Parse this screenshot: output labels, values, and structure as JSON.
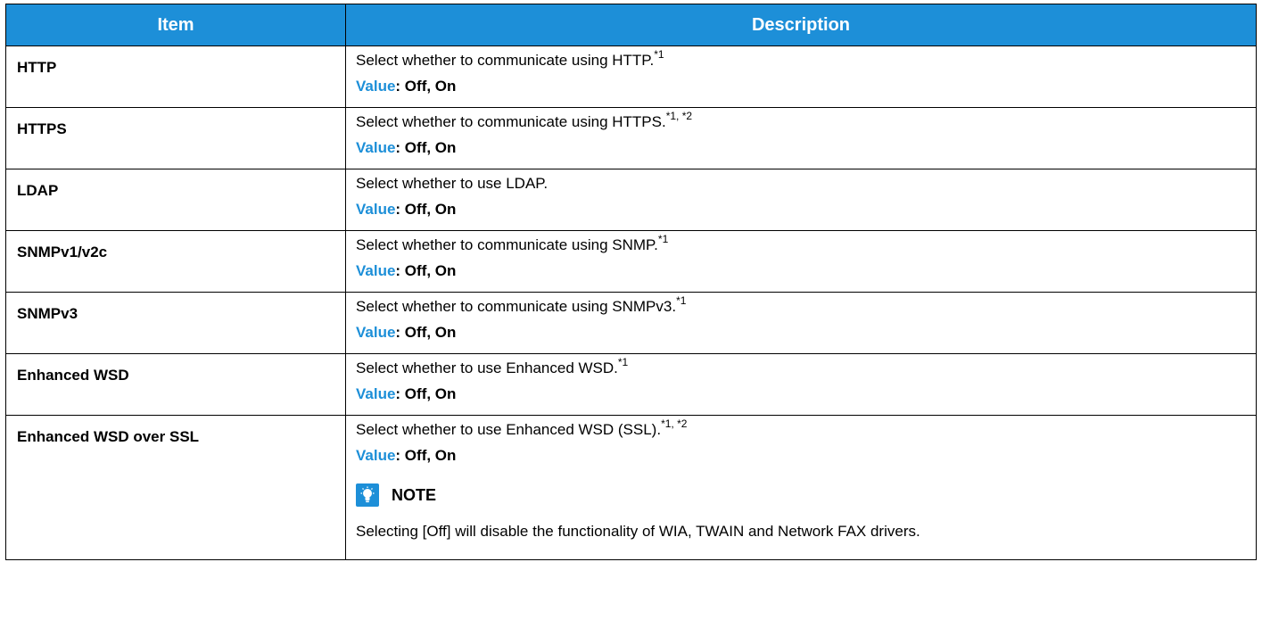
{
  "header": {
    "item": "Item",
    "description": "Description"
  },
  "value_label": "Value",
  "rows": [
    {
      "item": "HTTP",
      "desc": "Select whether to communicate using HTTP.",
      "sup": "*1",
      "value": ": Off, On"
    },
    {
      "item": "HTTPS",
      "desc": "Select whether to communicate using HTTPS.",
      "sup": "*1, *2",
      "value": ": Off, On"
    },
    {
      "item": "LDAP",
      "desc": "Select whether to use LDAP.",
      "sup": "",
      "value": ": Off, On"
    },
    {
      "item": "SNMPv1/v2c",
      "desc": "Select whether to communicate using SNMP.",
      "sup": "*1",
      "value": ": Off, On"
    },
    {
      "item": "SNMPv3",
      "desc": "Select whether to communicate using SNMPv3.",
      "sup": "*1",
      "value": ": Off, On"
    },
    {
      "item": "Enhanced WSD",
      "desc": "Select whether to use Enhanced WSD.",
      "sup": "*1",
      "value": ": Off, On"
    },
    {
      "item": "Enhanced WSD over SSL",
      "desc": "Select whether to use Enhanced WSD (SSL).",
      "sup": "*1, *2",
      "value": ": Off, On"
    }
  ],
  "note": {
    "title": "NOTE",
    "text": "Selecting [Off] will disable the functionality of WIA, TWAIN and Network FAX drivers.",
    "icon": "note-lightbulb-icon"
  },
  "colors": {
    "header_bg": "#1d8fd8",
    "value_label": "#1d8fd8"
  }
}
